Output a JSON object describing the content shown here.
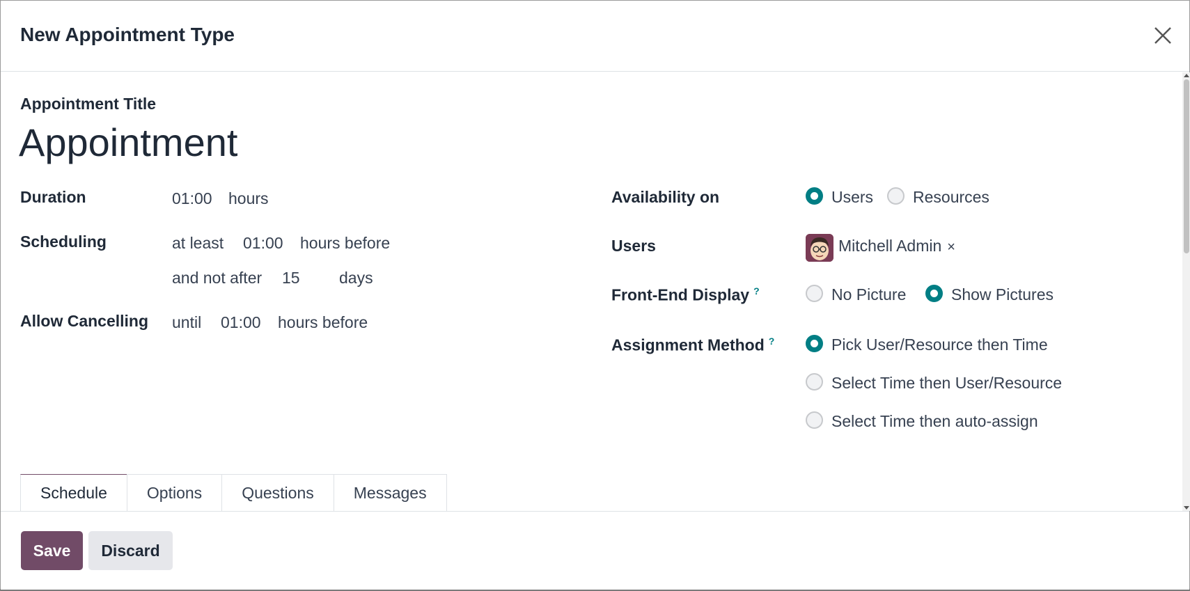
{
  "dialog": {
    "title": "New Appointment Type"
  },
  "form": {
    "title_label": "Appointment Title",
    "title_value": "Appointment",
    "duration": {
      "label": "Duration",
      "value": "01:00",
      "unit": "hours"
    },
    "scheduling": {
      "label": "Scheduling",
      "prefix": "at least",
      "min_value": "01:00",
      "min_unit": "hours before",
      "max_prefix": "and not after",
      "max_value": "15",
      "max_unit": "days"
    },
    "cancelling": {
      "label": "Allow Cancelling",
      "prefix": "until",
      "value": "01:00",
      "unit": "hours before"
    },
    "availability": {
      "label": "Availability on",
      "options": [
        "Users",
        "Resources"
      ],
      "selected": "Users"
    },
    "users": {
      "label": "Users",
      "tag": "Mitchell Admin",
      "remove": "×"
    },
    "front_end_display": {
      "label": "Front-End Display",
      "help": "?",
      "options": [
        "No Picture",
        "Show Pictures"
      ],
      "selected": "Show Pictures"
    },
    "assignment_method": {
      "label": "Assignment Method",
      "help": "?",
      "options": [
        "Pick User/Resource then Time",
        "Select Time then User/Resource",
        "Select Time then auto-assign"
      ],
      "selected": "Pick User/Resource then Time"
    }
  },
  "tabs": [
    "Schedule",
    "Options",
    "Questions",
    "Messages"
  ],
  "active_tab": "Schedule",
  "footer": {
    "save_label": "Save",
    "discard_label": "Discard"
  },
  "colors": {
    "primary": "#714b67",
    "radio_checked": "#017e84"
  }
}
